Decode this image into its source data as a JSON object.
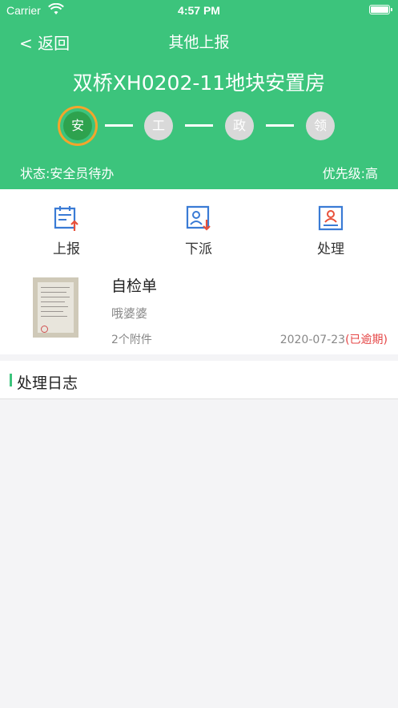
{
  "status_bar": {
    "carrier": "Carrier",
    "time": "4:57 PM"
  },
  "nav": {
    "back": "< 返回",
    "title": "其他上报"
  },
  "project": {
    "title": "双桥XH0202-11地块安置房"
  },
  "steps": [
    {
      "label": "安",
      "active": true
    },
    {
      "label": "工",
      "active": false
    },
    {
      "label": "政",
      "active": false
    },
    {
      "label": "领",
      "active": false
    }
  ],
  "status": {
    "state": "状态:安全员待办",
    "priority": "优先级:高"
  },
  "actions": [
    {
      "label": "上报",
      "icon": "report-upload-icon"
    },
    {
      "label": "下派",
      "icon": "dispatch-icon"
    },
    {
      "label": "处理",
      "icon": "handle-icon"
    }
  ],
  "task": {
    "title": "自检单",
    "person": "哦婆婆",
    "attachments": "2个附件",
    "date": "2020-07-23",
    "overdue": "(已逾期)"
  },
  "log": {
    "title": "处理日志"
  },
  "colors": {
    "primary": "#3cc47c",
    "active_step": "#2ea24e",
    "ring": "#f4a52c",
    "overdue": "#e54545",
    "icon_blue": "#3a7bd5",
    "icon_red": "#e8503a"
  }
}
